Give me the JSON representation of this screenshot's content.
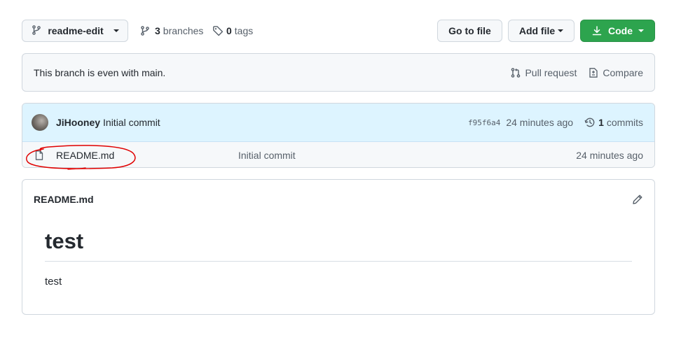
{
  "toolbar": {
    "branch_label": "readme-edit",
    "branches_count": "3",
    "branches_label": "branches",
    "tags_count": "0",
    "tags_label": "tags",
    "goto_file_label": "Go to file",
    "add_file_label": "Add file",
    "code_label": "Code"
  },
  "banner": {
    "text": "This branch is even with main.",
    "pull_request_label": "Pull request",
    "compare_label": "Compare"
  },
  "latest_commit": {
    "author": "JiHooney",
    "message": "Initial commit",
    "sha": "f95f6a4",
    "age": "24 minutes ago",
    "commits_count": "1",
    "commits_label": "commits"
  },
  "files": [
    {
      "name": "README.md",
      "message": "Initial commit",
      "age": "24 minutes ago"
    }
  ],
  "readme": {
    "title": "README.md",
    "heading": "test",
    "paragraph": "test"
  },
  "colors": {
    "code_button": "#2da44e",
    "commit_row_bg": "#ddf4ff",
    "annotation": "#e00000"
  },
  "icons": [
    "git-branch-icon",
    "tag-icon",
    "download-icon",
    "git-pull-request-icon",
    "diff-icon",
    "history-icon",
    "file-icon",
    "pencil-icon"
  ]
}
